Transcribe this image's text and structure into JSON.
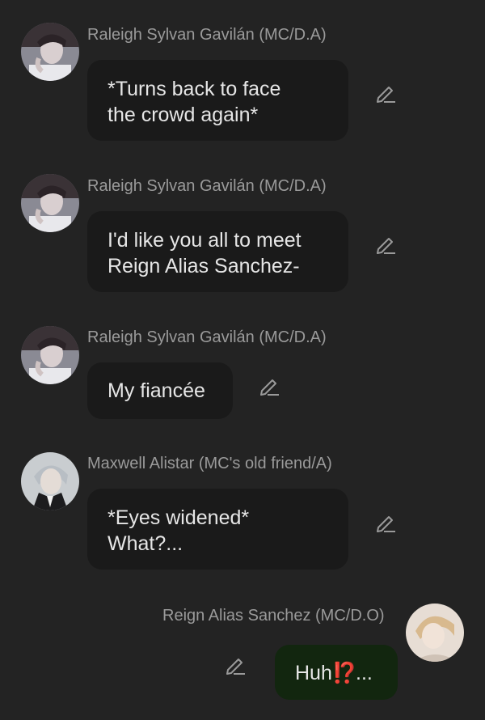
{
  "messages": [
    {
      "sender": "Raleigh Sylvan Gavilán (MC/D.A)",
      "lines": [
        "*Turns back to face",
        "the crowd again*"
      ],
      "avatar": "dark-hair-man-avatar"
    },
    {
      "sender": "Raleigh Sylvan Gavilán (MC/D.A)",
      "lines": [
        "I'd like you all to meet",
        "Reign Alias Sanchez-"
      ],
      "avatar": "dark-hair-man-avatar"
    },
    {
      "sender": "Raleigh Sylvan Gavilán (MC/D.A)",
      "lines": [
        "My fiancée"
      ],
      "avatar": "dark-hair-man-avatar"
    },
    {
      "sender": "Maxwell Alistar (MC's old friend/A)",
      "lines": [
        "*Eyes widened*",
        "What?..."
      ],
      "avatar": "silver-hair-man-avatar"
    },
    {
      "sender": "Reign Alias Sanchez (MC/D.O)",
      "text": "Huh",
      "emoji": "⁉️",
      "suffix": "...",
      "avatar": "blond-hair-man-avatar",
      "outgoing": true
    }
  ],
  "icons": {
    "edit": "pencil-edit-icon"
  },
  "colors": {
    "background": "#232323",
    "incoming_bubble": "#1a1a1a",
    "outgoing_bubble": "#12260f",
    "name_text": "#9a9a9a"
  }
}
